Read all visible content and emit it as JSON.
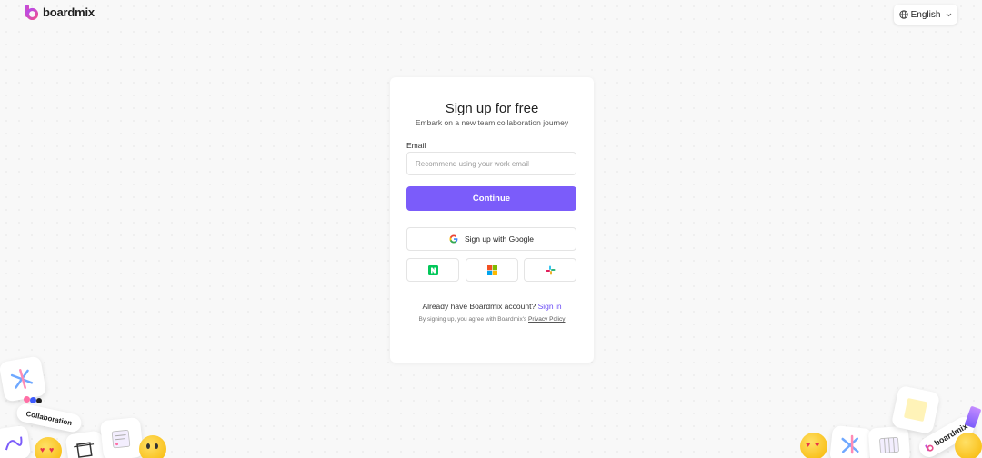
{
  "brand": {
    "name": "boardmix",
    "accent": "#7b5cfa"
  },
  "language": {
    "label": "English",
    "icon": "globe-icon"
  },
  "signup": {
    "title": "Sign up for free",
    "subtitle": "Embark on a new team collaboration journey",
    "email_label": "Email",
    "email_placeholder": "Recommend using your work email",
    "email_value": "",
    "continue_label": "Continue",
    "google_label": "Sign up with Google",
    "sso_icons": [
      "naver-icon",
      "microsoft-icon",
      "slack-icon"
    ],
    "account_prompt": "Already have Boardmix account?",
    "signin_link": "Sign in",
    "terms_prefix": "By signing up, you agree with Boardmix's",
    "privacy_link": "Privacy Policy"
  },
  "decor": {
    "collaboration_tag": "Collaboration",
    "boardmix_tag": "boardmix"
  }
}
